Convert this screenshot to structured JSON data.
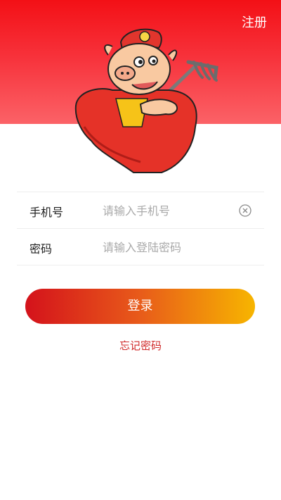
{
  "header": {
    "register_label": "注册"
  },
  "form": {
    "phone_label": "手机号",
    "phone_placeholder": "请输入手机号",
    "phone_value": "",
    "password_label": "密码",
    "password_placeholder": "请输入登陆密码",
    "password_value": ""
  },
  "actions": {
    "login_label": "登录",
    "forgot_label": "忘记密码"
  },
  "icons": {
    "clear": "clear-circle-icon",
    "mascot": "pig-mascot-icon"
  },
  "colors": {
    "header_top": "#f31016",
    "header_bottom": "#fb6267",
    "button_start": "#d4121b",
    "button_end": "#f7b500",
    "forgot_text": "#d02a2a"
  }
}
